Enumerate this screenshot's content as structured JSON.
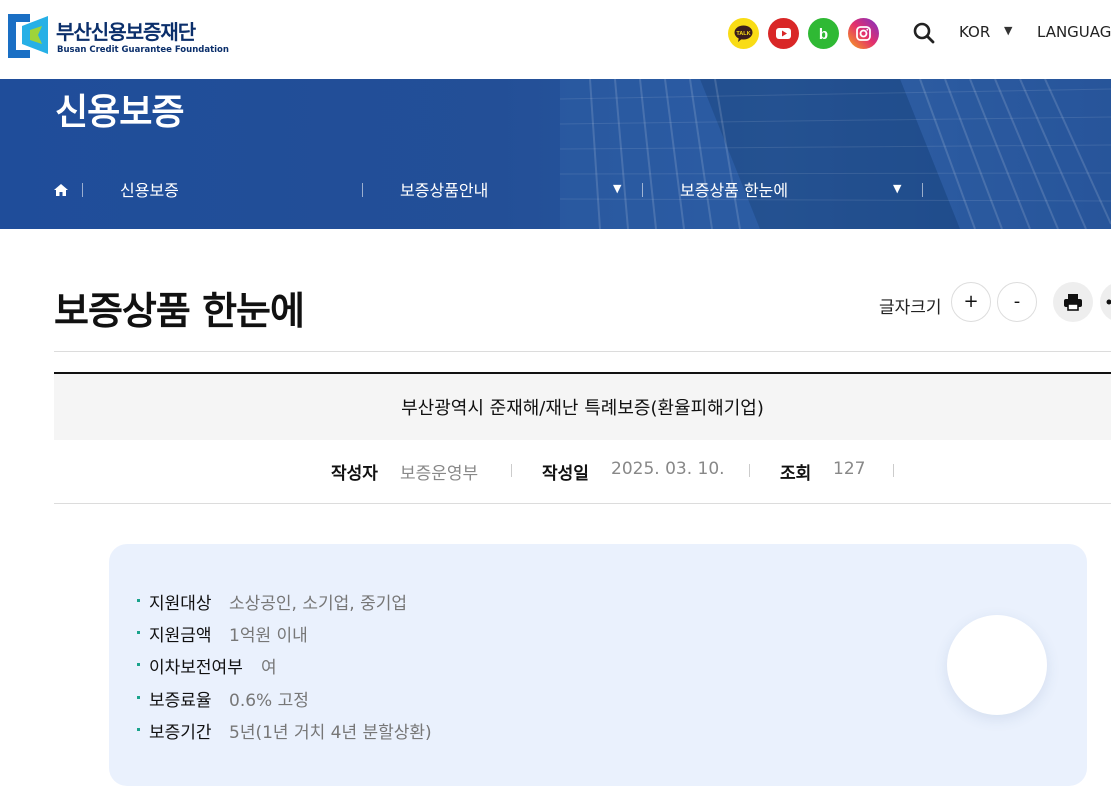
{
  "header": {
    "logo_name": "부산신용보증재단",
    "logo_sub": "Busan Credit Guarantee Foundation",
    "sns": [
      {
        "name": "kakaotalk",
        "icon": "kakaotalk-icon",
        "color": "#f9dc15"
      },
      {
        "name": "youtube",
        "icon": "youtube-icon",
        "color": "#d92727"
      },
      {
        "name": "blog",
        "icon": "blog-icon",
        "color": "#2fb934"
      },
      {
        "name": "instagram",
        "icon": "instagram-icon",
        "color": "#e3306c"
      }
    ],
    "lang_current": "KOR",
    "language_label": "LANGUAG"
  },
  "banner": {
    "title": "신용보증",
    "breadcrumb": [
      "신용보증",
      "보증상품안내",
      "보증상품 한눈에"
    ]
  },
  "content": {
    "page_title": "보증상품 한눈에",
    "font_size_label": "글자크기",
    "font_increase": "+",
    "font_decrease": "-"
  },
  "post": {
    "title": "부산광역시 준재해/재난 특례보증(환율피해기업)",
    "meta": {
      "author_label": "작성자",
      "author": "보증운영부",
      "date_label": "작성일",
      "date": "2025. 03. 10.",
      "views_label": "조회",
      "views": "127"
    }
  },
  "info": {
    "items": [
      {
        "key": "지원대상",
        "value": "소상공인, 소기업, 중기업"
      },
      {
        "key": "지원금액",
        "value": "1억원 이내"
      },
      {
        "key": "이차보전여부",
        "value": "여"
      },
      {
        "key": "보증료율",
        "value": "0.6% 고정"
      },
      {
        "key": "보증기간",
        "value": "5년(1년 거치 4년 분할상환)"
      }
    ]
  },
  "colors": {
    "brand_navy": "#0b2f6b",
    "banner_blue": "#234f97",
    "accent_teal": "#1aa38c",
    "info_bg": "#eaf1fd"
  }
}
